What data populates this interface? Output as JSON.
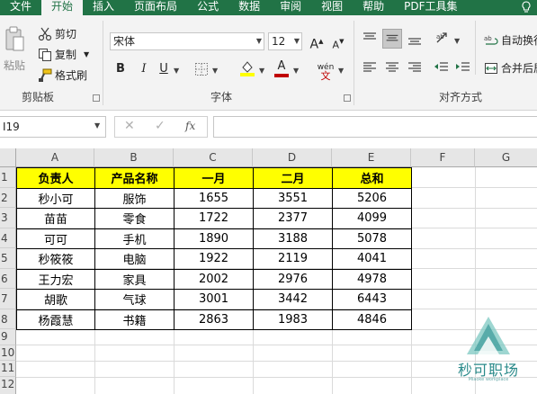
{
  "ribbon_tabs": [
    {
      "label": "文件",
      "active": false
    },
    {
      "label": "开始",
      "active": true
    },
    {
      "label": "插入",
      "active": false
    },
    {
      "label": "页面布局",
      "active": false
    },
    {
      "label": "公式",
      "active": false
    },
    {
      "label": "数据",
      "active": false
    },
    {
      "label": "审阅",
      "active": false
    },
    {
      "label": "视图",
      "active": false
    },
    {
      "label": "帮助",
      "active": false
    },
    {
      "label": "PDF工具集",
      "active": false
    }
  ],
  "clipboard": {
    "paste_label": "粘贴",
    "cut_label": "剪切",
    "copy_label": "复制",
    "format_painter_label": "格式刷",
    "group_label": "剪贴板"
  },
  "font": {
    "font_name": "宋体",
    "font_size": "12",
    "bold": "B",
    "italic": "I",
    "underline": "U",
    "grow": "A",
    "shrink": "A",
    "phonetic": "wén",
    "font_color_letter": "A",
    "group_label": "字体"
  },
  "alignment": {
    "wrap_label": "自动换行",
    "merge_label": "合并后居中",
    "group_label": "对齐方式"
  },
  "formula_bar": {
    "name_box": "I19",
    "fx": "fx",
    "formula": ""
  },
  "columns": [
    "A",
    "B",
    "C",
    "D",
    "E",
    "F",
    "G"
  ],
  "rows": [
    "1",
    "2",
    "3",
    "4",
    "5",
    "6",
    "7",
    "8",
    "9",
    "10",
    "11",
    "12"
  ],
  "table": {
    "headers": [
      "负责人",
      "产品名称",
      "一月",
      "二月",
      "总和"
    ],
    "rows": [
      [
        "秒小可",
        "服饰",
        "1655",
        "3551",
        "5206"
      ],
      [
        "苗苗",
        "零食",
        "1722",
        "2377",
        "4099"
      ],
      [
        "可可",
        "手机",
        "1890",
        "3188",
        "5078"
      ],
      [
        "秒筱筱",
        "电脑",
        "1922",
        "2119",
        "4041"
      ],
      [
        "王力宏",
        "家具",
        "2002",
        "2976",
        "4978"
      ],
      [
        "胡歌",
        "气球",
        "3001",
        "3442",
        "6443"
      ],
      [
        "杨霞慧",
        "书籍",
        "2863",
        "1983",
        "4846"
      ]
    ],
    "header_fill": "#ffff00"
  },
  "watermark": {
    "name": "秒可职场",
    "sub": "Miaoke workplace"
  },
  "colors": {
    "ribbon_green": "#217346",
    "font_color_bar": "#c00000",
    "highlight_bar": "#ffff00"
  }
}
